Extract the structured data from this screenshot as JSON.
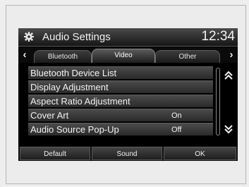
{
  "header": {
    "title": "Audio Settings",
    "time": "12:34",
    "icon": "gear-icon"
  },
  "tabs": [
    {
      "label": "Bluetooth",
      "active": false
    },
    {
      "label": "Video",
      "active": true
    },
    {
      "label": "Other",
      "active": false
    }
  ],
  "nav": {
    "prev": "‹",
    "next": "›"
  },
  "menu": {
    "items": [
      {
        "label": "Bluetooth Device List",
        "value": ""
      },
      {
        "label": "Display Adjustment",
        "value": ""
      },
      {
        "label": "Aspect Ratio Adjustment",
        "value": ""
      },
      {
        "label": "Cover Art",
        "value": "On"
      },
      {
        "label": "Audio Source Pop-Up",
        "value": "Off"
      }
    ]
  },
  "scroll": {
    "up": "up-chevron-icon",
    "down": "down-chevron-icon"
  },
  "footer": {
    "default": "Default",
    "sound": "Sound",
    "ok": "OK"
  }
}
